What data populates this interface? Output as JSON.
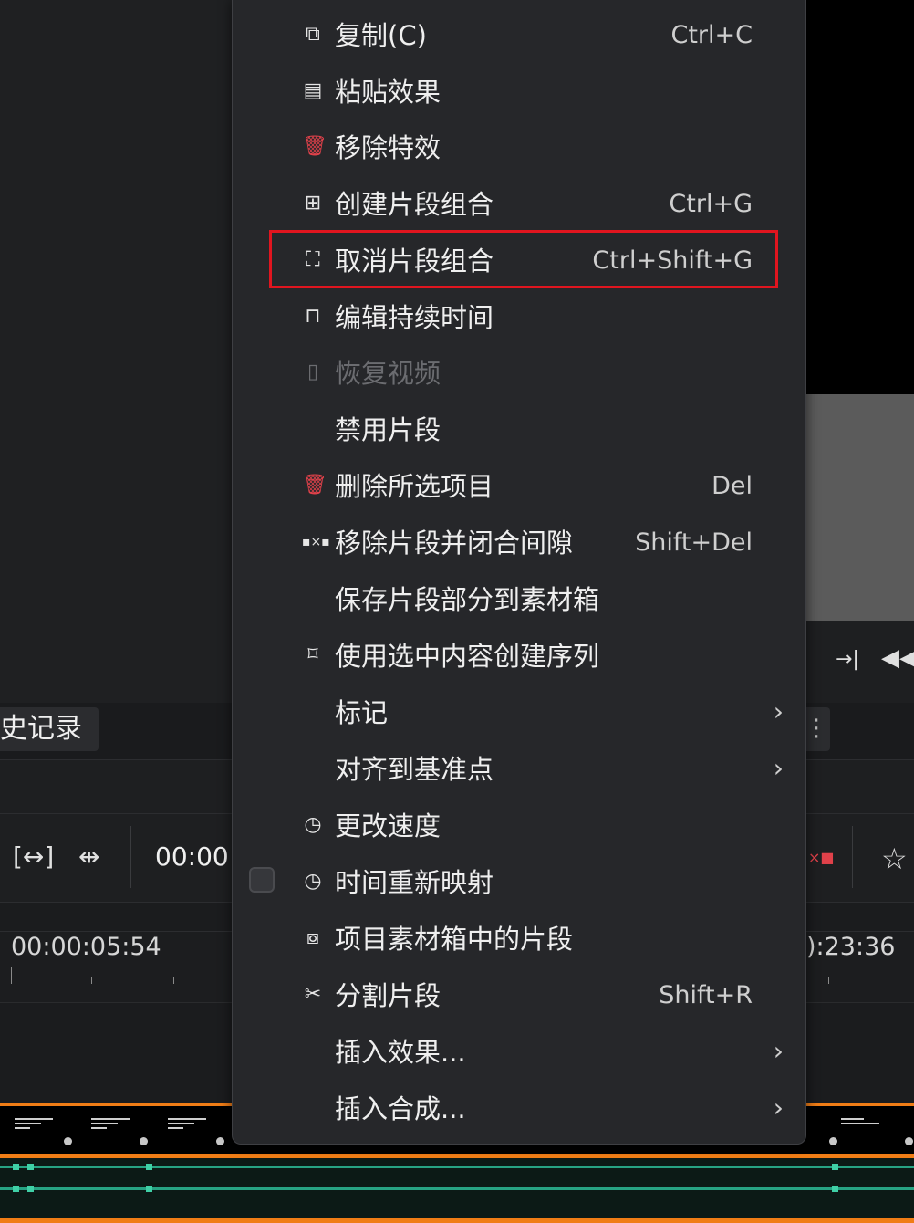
{
  "background": {
    "history_tab_label": "史记录",
    "right_tab_glyph": "⋮",
    "timecode_partial": "00:00:",
    "ruler_left": "00:00:05:54",
    "ruler_right": "):23:36",
    "toolbar_icons": [
      "fit-zone-icon",
      "insert-zone-icon",
      "marker-x-icon",
      "star-icon",
      "goto-out-icon",
      "rewind-icon"
    ]
  },
  "context_menu": {
    "items": [
      {
        "icon": "copy-icon",
        "label": "复制(C)",
        "shortcut": "Ctrl+C",
        "submenu": false,
        "disabled": false
      },
      {
        "icon": "paste-icon",
        "label": "粘贴效果",
        "shortcut": "",
        "submenu": false,
        "disabled": false
      },
      {
        "icon": "trash-icon",
        "label": "移除特效",
        "shortcut": "",
        "submenu": false,
        "disabled": false
      },
      {
        "icon": "group-icon",
        "label": "创建片段组合",
        "shortcut": "Ctrl+G",
        "submenu": false,
        "disabled": false
      },
      {
        "icon": "ungroup-icon",
        "label": "取消片段组合",
        "shortcut": "Ctrl+Shift+G",
        "submenu": false,
        "disabled": false,
        "highlighted": true
      },
      {
        "icon": "duration-icon",
        "label": "编辑持续时间",
        "shortcut": "",
        "submenu": false,
        "disabled": false
      },
      {
        "icon": "restore-video-icon",
        "label": "恢复视频",
        "shortcut": "",
        "submenu": false,
        "disabled": true
      },
      {
        "icon": "",
        "label": "禁用片段",
        "shortcut": "",
        "submenu": false,
        "disabled": false
      },
      {
        "icon": "trash-icon",
        "label": "删除所选项目",
        "shortcut": "Del",
        "submenu": false,
        "disabled": false
      },
      {
        "icon": "ripple-delete-icon",
        "label": "移除片段并闭合间隙",
        "shortcut": "Shift+Del",
        "submenu": false,
        "disabled": false
      },
      {
        "icon": "",
        "label": "保存片段部分到素材箱",
        "shortcut": "",
        "submenu": false,
        "disabled": false
      },
      {
        "icon": "new-sequence-icon",
        "label": "使用选中内容创建序列",
        "shortcut": "",
        "submenu": false,
        "disabled": false
      },
      {
        "icon": "",
        "label": "标记",
        "shortcut": "",
        "submenu": true,
        "disabled": false
      },
      {
        "icon": "",
        "label": "对齐到基准点",
        "shortcut": "",
        "submenu": true,
        "disabled": false
      },
      {
        "icon": "speed-icon",
        "label": "更改速度",
        "shortcut": "",
        "submenu": false,
        "disabled": false
      },
      {
        "icon": "speed-icon",
        "label": "时间重新映射",
        "shortcut": "",
        "submenu": false,
        "disabled": false,
        "checkbox": true,
        "checked": false
      },
      {
        "icon": "bin-clip-icon",
        "label": "项目素材箱中的片段",
        "shortcut": "",
        "submenu": false,
        "disabled": false
      },
      {
        "icon": "cut-icon",
        "label": "分割片段",
        "shortcut": "Shift+R",
        "submenu": false,
        "disabled": false
      },
      {
        "icon": "",
        "label": "插入效果...",
        "shortcut": "",
        "submenu": true,
        "disabled": false
      },
      {
        "icon": "",
        "label": "插入合成...",
        "shortcut": "",
        "submenu": true,
        "disabled": false
      }
    ]
  },
  "colors": {
    "menu_bg": "#26272a",
    "highlight_border": "#e0151f",
    "trash_icon": "#e0414a",
    "track_accent": "#f07d16",
    "audio_line": "#27a383"
  }
}
